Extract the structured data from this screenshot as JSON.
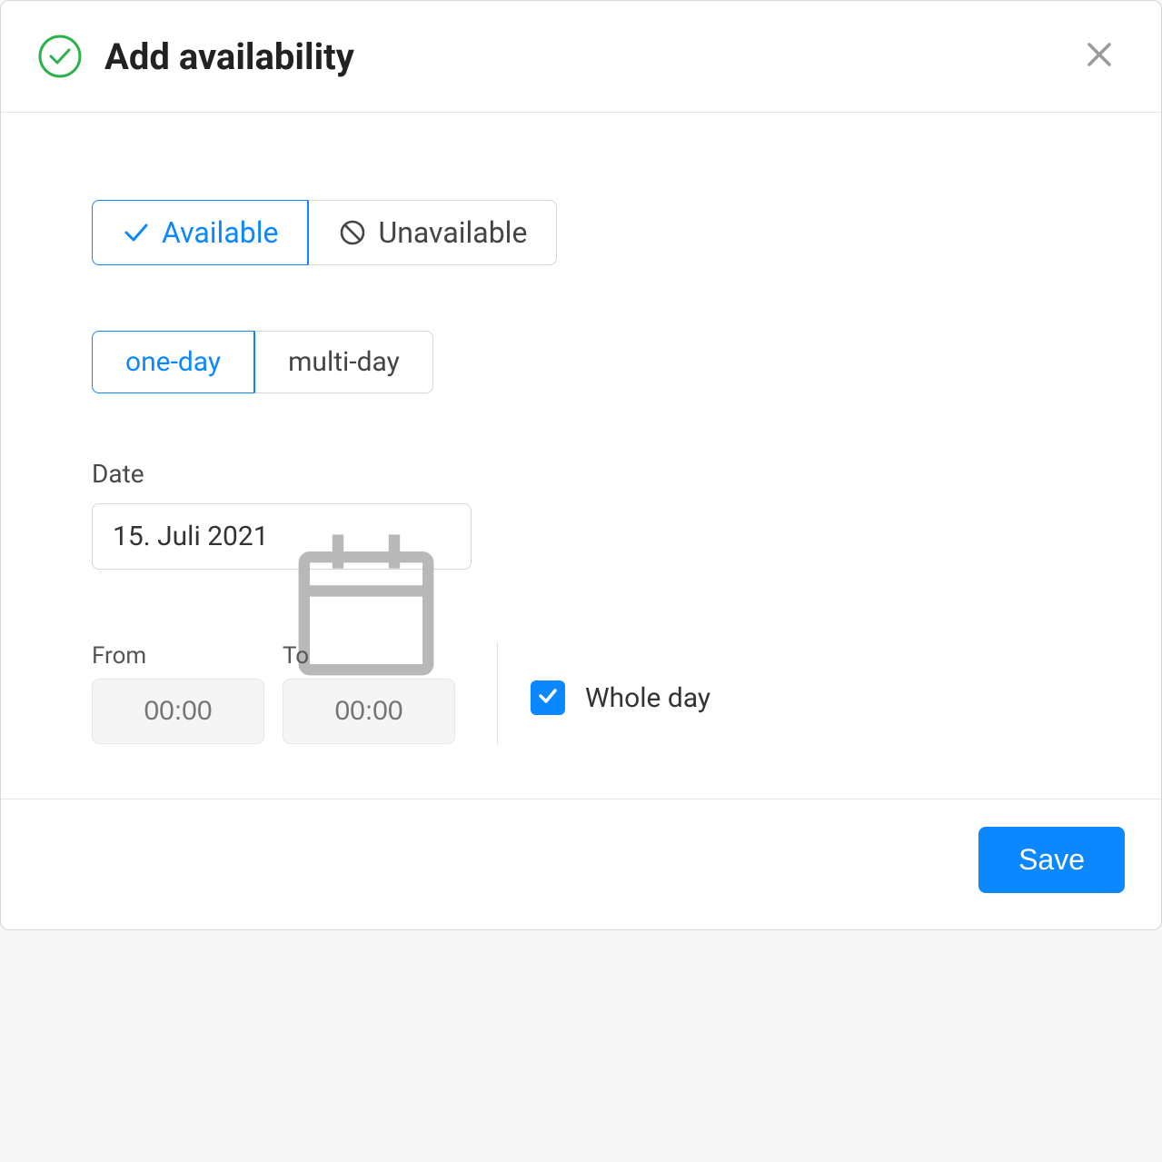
{
  "header": {
    "title": "Add availability"
  },
  "availability": {
    "available_label": "Available",
    "unavailable_label": "Unavailable"
  },
  "duration": {
    "one_day_label": "one-day",
    "multi_day_label": "multi-day"
  },
  "date": {
    "label": "Date",
    "value": "15. Juli 2021"
  },
  "time": {
    "from_label": "From",
    "from_placeholder": "00:00",
    "to_label": "To",
    "to_placeholder": "00:00"
  },
  "whole_day": {
    "label": "Whole day",
    "checked": true
  },
  "footer": {
    "save_label": "Save"
  }
}
